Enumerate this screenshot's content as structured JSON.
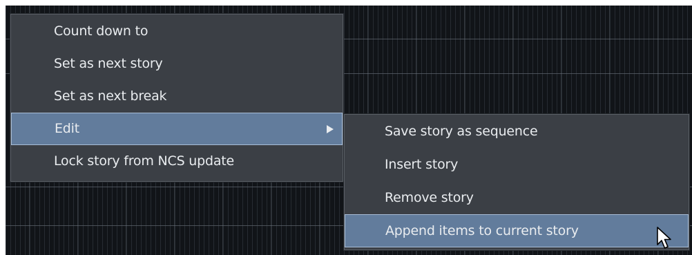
{
  "context_menu": {
    "items": [
      {
        "label": "Count down to",
        "active": false,
        "has_submenu": false
      },
      {
        "label": "Set as next story",
        "active": false,
        "has_submenu": false
      },
      {
        "label": "Set as next break",
        "active": false,
        "has_submenu": false
      },
      {
        "label": "Edit",
        "active": true,
        "has_submenu": true
      },
      {
        "label": "Lock story from NCS update",
        "active": false,
        "has_submenu": false
      }
    ]
  },
  "submenu_edit": {
    "items": [
      {
        "label": "Save story as sequence",
        "active": false
      },
      {
        "label": "Insert story",
        "active": false
      },
      {
        "label": "Remove story",
        "active": false
      },
      {
        "label": "Append items to current story",
        "active": true
      }
    ]
  },
  "icons": {
    "submenu_arrow": "chevron-right-icon",
    "cursor": "mouse-pointer-icon"
  },
  "colors": {
    "menu_background": "#3b3f45",
    "highlight_background": "#627c9c",
    "highlight_border": "#a8bdd6",
    "text": "#e9ecef",
    "app_background": "#111418"
  }
}
